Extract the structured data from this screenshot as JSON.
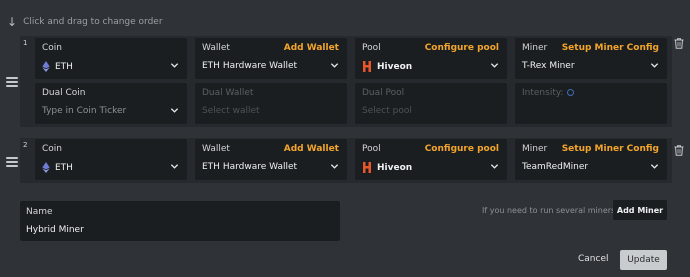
{
  "hint": {
    "text": "Click and drag to change order"
  },
  "rows": [
    {
      "number": "1",
      "coin": {
        "label": "Coin",
        "value": "ETH"
      },
      "wallet": {
        "label": "Wallet",
        "action": "Add Wallet",
        "value": "ETH Hardware Wallet"
      },
      "pool": {
        "label": "Pool",
        "action": "Configure pool",
        "value": "Hiveon"
      },
      "miner": {
        "label": "Miner",
        "action": "Setup Miner Config",
        "value": "T-Rex Miner"
      },
      "dual_coin": {
        "label": "Dual Coin",
        "placeholder": "Type in Coin Ticker"
      },
      "dual_wallet": {
        "label": "Dual Wallet",
        "placeholder": "Select wallet"
      },
      "dual_pool": {
        "label": "Dual Pool",
        "placeholder": "Select pool"
      },
      "intensity": {
        "label": "Intensity:"
      }
    },
    {
      "number": "2",
      "coin": {
        "label": "Coin",
        "value": "ETH"
      },
      "wallet": {
        "label": "Wallet",
        "action": "Add Wallet",
        "value": "ETH Hardware Wallet"
      },
      "pool": {
        "label": "Pool",
        "action": "Configure pool",
        "value": "Hiveon"
      },
      "miner": {
        "label": "Miner",
        "action": "Setup Miner Config",
        "value": "TeamRedMiner"
      }
    }
  ],
  "name": {
    "label": "Name",
    "value": "Hybrid Miner"
  },
  "several_miners": {
    "text": "If you need to run several miners",
    "button": "Add Miner"
  },
  "footer": {
    "cancel": "Cancel",
    "update": "Update"
  },
  "colors": {
    "accent": "#f3a52b",
    "eth": "#6f7cd6",
    "hiveon": "#e8562a",
    "background": "#2f3236",
    "card": "#1b1e21"
  },
  "icons": [
    "arrow-down-icon",
    "drag-handle-icon",
    "eth-icon",
    "hiveon-icon",
    "chevron-down-icon",
    "trash-icon",
    "info-icon"
  ]
}
